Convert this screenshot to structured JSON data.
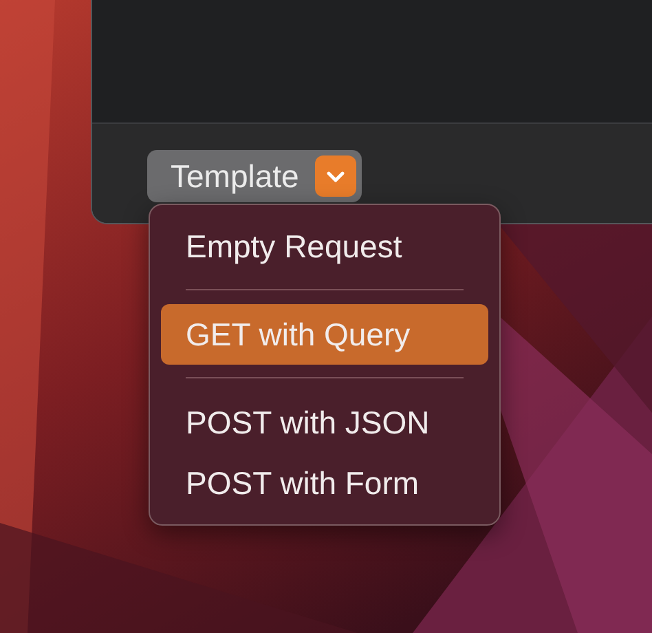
{
  "popup_button": {
    "label": "Template",
    "expanded": true
  },
  "menu": {
    "items": [
      {
        "kind": "item",
        "label": "Empty Request",
        "selected": false
      },
      {
        "kind": "separator"
      },
      {
        "kind": "item",
        "label": "GET with Query",
        "selected": true
      },
      {
        "kind": "separator"
      },
      {
        "kind": "item",
        "label": "POST with JSON",
        "selected": false
      },
      {
        "kind": "item",
        "label": "POST with Form",
        "selected": false
      }
    ]
  }
}
